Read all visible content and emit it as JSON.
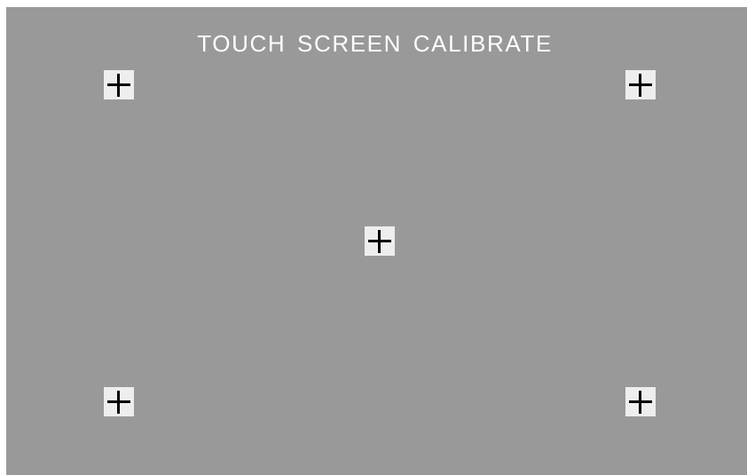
{
  "title": "TOUCH SCREEN CALIBRATE",
  "targets": [
    {
      "name": "top-left",
      "icon": "crosshair-icon"
    },
    {
      "name": "top-right",
      "icon": "crosshair-icon"
    },
    {
      "name": "center",
      "icon": "crosshair-icon"
    },
    {
      "name": "bottom-left",
      "icon": "crosshair-icon"
    },
    {
      "name": "bottom-right",
      "icon": "crosshair-icon"
    }
  ],
  "colors": {
    "background": "#999999",
    "border": "#ffffff",
    "title": "#ffffff",
    "target_background": "#eeeeee",
    "crosshair": "#000000"
  }
}
